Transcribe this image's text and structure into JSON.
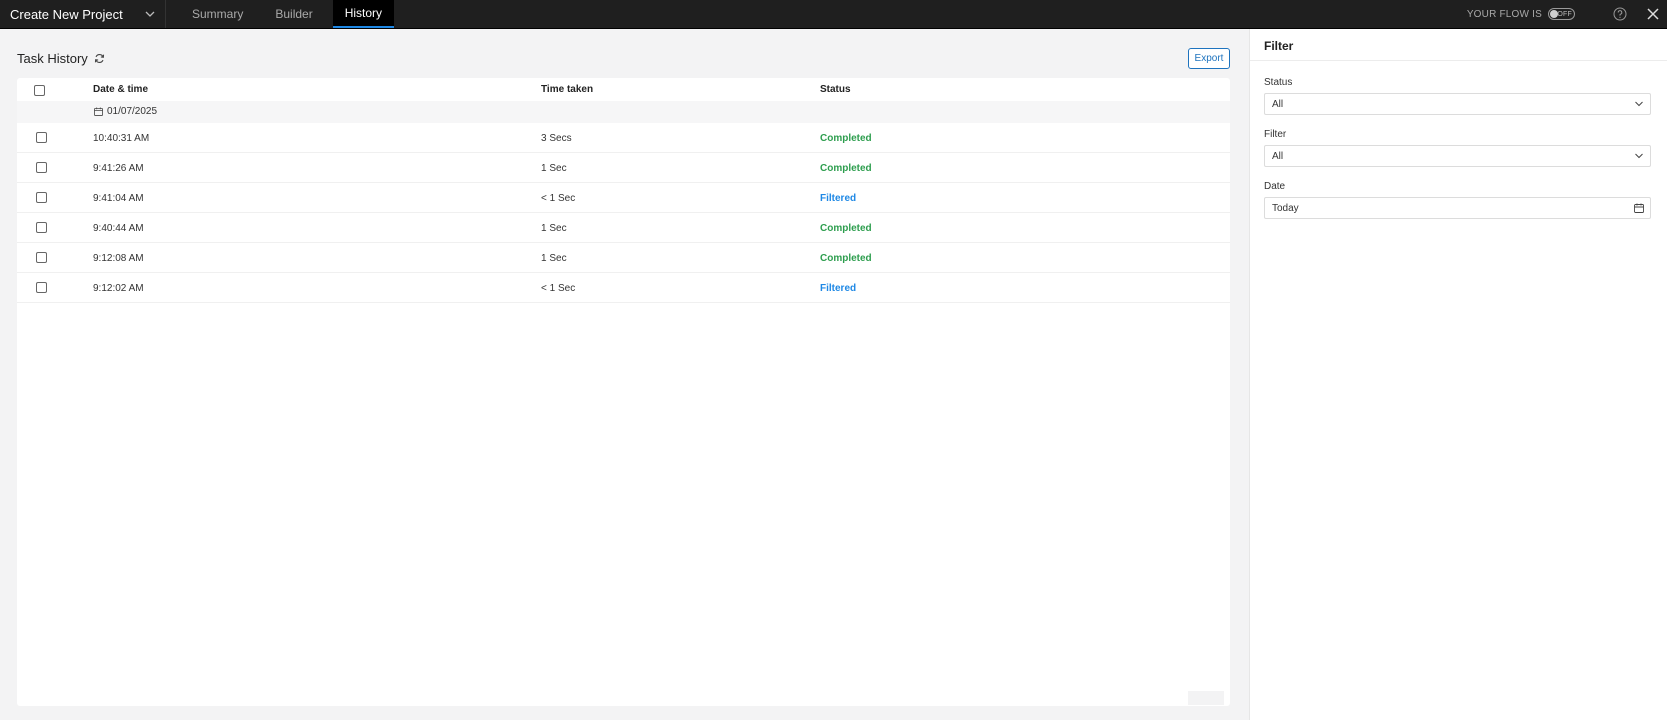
{
  "topbar": {
    "project_name": "Create New Project",
    "tabs": [
      {
        "label": "Summary"
      },
      {
        "label": "Builder"
      },
      {
        "label": "History"
      }
    ],
    "flow_label": "YOUR FLOW IS",
    "flow_state": "OFF"
  },
  "main": {
    "title": "Task History",
    "export_label": "Export",
    "columns": {
      "date": "Date & time",
      "time": "Time taken",
      "status": "Status"
    },
    "group_date": "01/07/2025",
    "rows": [
      {
        "time": "10:40:31 AM",
        "taken": "3 Secs",
        "status": "Completed"
      },
      {
        "time": "9:41:26 AM",
        "taken": "1 Sec",
        "status": "Completed"
      },
      {
        "time": "9:41:04 AM",
        "taken": "< 1 Sec",
        "status": "Filtered"
      },
      {
        "time": "9:40:44 AM",
        "taken": "1 Sec",
        "status": "Completed"
      },
      {
        "time": "9:12:08 AM",
        "taken": "1 Sec",
        "status": "Completed"
      },
      {
        "time": "9:12:02 AM",
        "taken": "< 1 Sec",
        "status": "Filtered"
      }
    ]
  },
  "filter_panel": {
    "title": "Filter",
    "status_label": "Status",
    "status_value": "All",
    "filter_label": "Filter",
    "filter_value": "All",
    "date_label": "Date",
    "date_value": "Today"
  },
  "colors": {
    "completed": "#2e9e4f",
    "filtered": "#1e88e5",
    "accent": "#1e73be"
  }
}
